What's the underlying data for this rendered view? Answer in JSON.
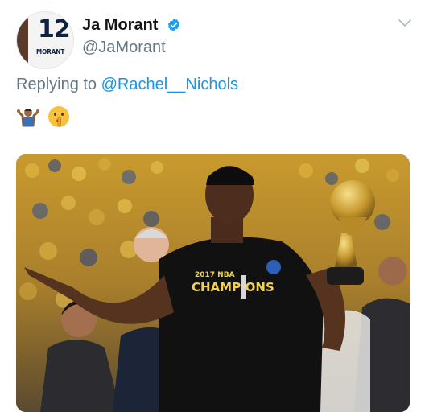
{
  "tweet": {
    "author": {
      "display_name": "Ja Morant",
      "handle": "@JaMorant",
      "avatar": {
        "jersey_number": "12",
        "jersey_name": "MORANT"
      },
      "verified_icon": "verified-badge-icon"
    },
    "menu_icon": "chevron-down-icon",
    "reply": {
      "prefix": "Replying to",
      "mention": "@Rachel__Nichols"
    },
    "emojis": [
      "person-shrugging-emoji",
      "shushing-face-emoji"
    ],
    "media": {
      "shirt_text_top": "2017 NBA",
      "shirt_text_main": "CHAMPIONS"
    }
  },
  "colors": {
    "text_primary": "#14171a",
    "text_secondary": "#657786",
    "link": "#1b95e0",
    "verified": "#1da1f2",
    "crowd_gold": "#e0b13a"
  }
}
